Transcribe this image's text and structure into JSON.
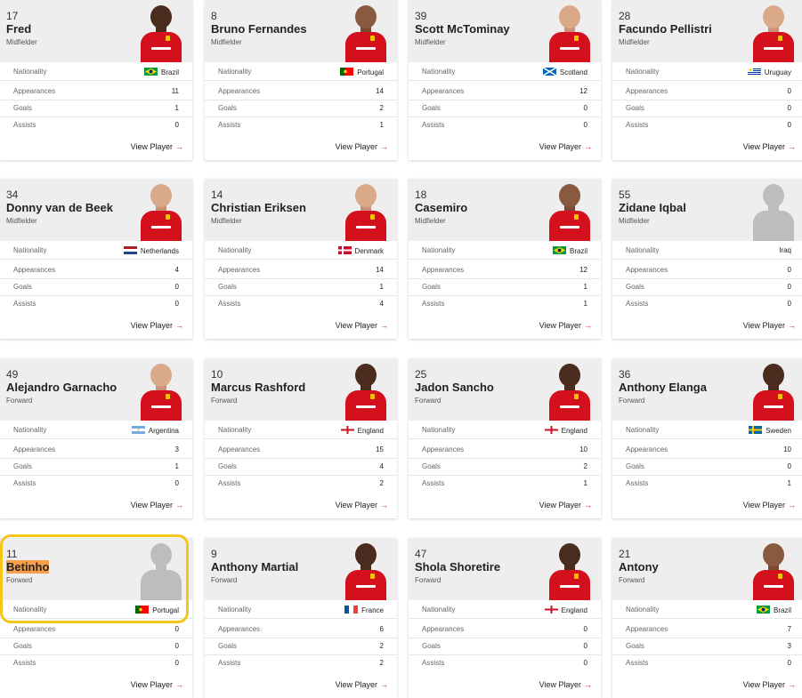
{
  "ui": {
    "view_label": "View Player",
    "arrow": "→",
    "labels": {
      "nationality": "Nationality",
      "appearances": "Appearances",
      "goals": "Goals",
      "assists": "Assists"
    }
  },
  "players": [
    {
      "number": "17",
      "name": "Fred",
      "position": "Midfielder",
      "nationality": "Brazil",
      "flag": "brazil",
      "apps": "11",
      "goals": "1",
      "assists": "0",
      "photo": "dark"
    },
    {
      "number": "8",
      "name": "Bruno Fernandes",
      "position": "Midfielder",
      "nationality": "Portugal",
      "flag": "portugal",
      "apps": "14",
      "goals": "2",
      "assists": "1",
      "photo": "mid"
    },
    {
      "number": "39",
      "name": "Scott McTominay",
      "position": "Midfielder",
      "nationality": "Scotland",
      "flag": "scotland",
      "apps": "12",
      "goals": "0",
      "assists": "0",
      "photo": "light"
    },
    {
      "number": "28",
      "name": "Facundo Pellistri",
      "position": "Midfielder",
      "nationality": "Uruguay",
      "flag": "uruguay",
      "apps": "0",
      "goals": "0",
      "assists": "0",
      "photo": "light"
    },
    {
      "number": "34",
      "name": "Donny van de Beek",
      "position": "Midfielder",
      "nationality": "Netherlands",
      "flag": "netherlands",
      "apps": "4",
      "goals": "0",
      "assists": "0",
      "photo": "light"
    },
    {
      "number": "14",
      "name": "Christian Eriksen",
      "position": "Midfielder",
      "nationality": "Denmark",
      "flag": "denmark",
      "apps": "14",
      "goals": "1",
      "assists": "4",
      "photo": "light"
    },
    {
      "number": "18",
      "name": "Casemiro",
      "position": "Midfielder",
      "nationality": "Brazil",
      "flag": "brazil",
      "apps": "12",
      "goals": "1",
      "assists": "1",
      "photo": "mid"
    },
    {
      "number": "55",
      "name": "Zidane Iqbal",
      "position": "Midfielder",
      "nationality": "Iraq",
      "flag": "",
      "apps": "0",
      "goals": "0",
      "assists": "0",
      "photo": "silhouette"
    },
    {
      "number": "49",
      "name": "Alejandro Garnacho",
      "position": "Forward",
      "nationality": "Argentina",
      "flag": "argentina",
      "apps": "3",
      "goals": "1",
      "assists": "0",
      "photo": "light"
    },
    {
      "number": "10",
      "name": "Marcus Rashford",
      "position": "Forward",
      "nationality": "England",
      "flag": "england",
      "apps": "15",
      "goals": "4",
      "assists": "2",
      "photo": "dark"
    },
    {
      "number": "25",
      "name": "Jadon Sancho",
      "position": "Forward",
      "nationality": "England",
      "flag": "england",
      "apps": "10",
      "goals": "2",
      "assists": "1",
      "photo": "dark"
    },
    {
      "number": "36",
      "name": "Anthony Elanga",
      "position": "Forward",
      "nationality": "Sweden",
      "flag": "sweden",
      "apps": "10",
      "goals": "0",
      "assists": "1",
      "photo": "dark"
    },
    {
      "number": "11",
      "name": "Betinho",
      "position": "Forward",
      "nationality": "Portugal",
      "flag": "portugal",
      "apps": "0",
      "goals": "0",
      "assists": "0",
      "photo": "silhouette"
    },
    {
      "number": "9",
      "name": "Anthony Martial",
      "position": "Forward",
      "nationality": "France",
      "flag": "france",
      "apps": "6",
      "goals": "2",
      "assists": "2",
      "photo": "dark"
    },
    {
      "number": "47",
      "name": "Shola Shoretire",
      "position": "Forward",
      "nationality": "England",
      "flag": "england",
      "apps": "0",
      "goals": "0",
      "assists": "0",
      "photo": "dark"
    },
    {
      "number": "21",
      "name": "Antony",
      "position": "Forward",
      "nationality": "Brazil",
      "flag": "brazil",
      "apps": "7",
      "goals": "3",
      "assists": "0",
      "photo": "mid"
    }
  ],
  "highlight": {
    "player_index": 12,
    "color": "#f5c518"
  }
}
